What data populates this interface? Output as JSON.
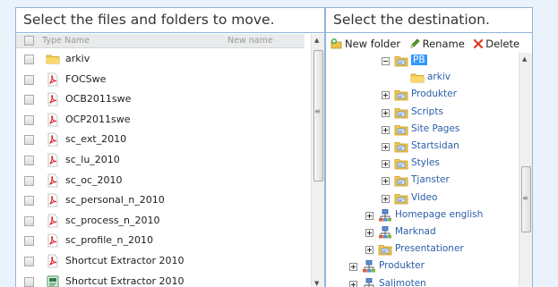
{
  "source_panel": {
    "title": "Select the files and folders to move.",
    "columns": {
      "type": "Type",
      "name": "Name",
      "new_name": "New name"
    },
    "rows": [
      {
        "name": "arkiv",
        "icon": "folder-icon"
      },
      {
        "name": "FOCSwe",
        "icon": "pdf-icon"
      },
      {
        "name": "OCB2011swe",
        "icon": "pdf-icon"
      },
      {
        "name": "OCP2011swe",
        "icon": "pdf-icon"
      },
      {
        "name": "sc_ext_2010",
        "icon": "pdf-icon"
      },
      {
        "name": "sc_lu_2010",
        "icon": "pdf-icon"
      },
      {
        "name": "sc_oc_2010",
        "icon": "pdf-icon"
      },
      {
        "name": "sc_personal_n_2010",
        "icon": "pdf-icon"
      },
      {
        "name": "sc_process_n_2010",
        "icon": "pdf-icon"
      },
      {
        "name": "sc_profile_n_2010",
        "icon": "pdf-icon"
      },
      {
        "name": "Shortcut Extractor 2010",
        "icon": "pdf-icon"
      },
      {
        "name": "Shortcut Extractor 2010",
        "icon": "publisher-icon"
      }
    ]
  },
  "destination_panel": {
    "title": "Select the destination.",
    "toolbar": {
      "new_folder": "New folder",
      "rename": "Rename",
      "delete": "Delete"
    },
    "tree": [
      {
        "label": "PB",
        "icon": "site-folder-icon",
        "expander": "minus",
        "selected": true
      },
      {
        "label": "arkiv",
        "icon": "folder-icon",
        "expander": "none"
      },
      {
        "label": "Produkter",
        "icon": "site-folder-icon",
        "expander": "plus"
      },
      {
        "label": "Scripts",
        "icon": "site-folder-icon",
        "expander": "plus"
      },
      {
        "label": "Site Pages",
        "icon": "site-folder-icon",
        "expander": "plus"
      },
      {
        "label": "Startsidan",
        "icon": "site-folder-icon",
        "expander": "plus"
      },
      {
        "label": "Styles",
        "icon": "site-folder-icon",
        "expander": "plus"
      },
      {
        "label": "Tjanster",
        "icon": "site-folder-icon",
        "expander": "plus"
      },
      {
        "label": "Video",
        "icon": "site-folder-icon",
        "expander": "plus"
      },
      {
        "label": "Homepage english",
        "icon": "site-icon",
        "expander": "plus"
      },
      {
        "label": "Marknad",
        "icon": "site-icon",
        "expander": "plus"
      },
      {
        "label": "Presentationer",
        "icon": "site-folder-icon",
        "expander": "plus"
      },
      {
        "label": "Produkter",
        "icon": "site-icon",
        "expander": "plus"
      },
      {
        "label": "Saljmoten",
        "icon": "site-icon",
        "expander": "plus"
      }
    ]
  },
  "colors": {
    "border": "#8fb4d9",
    "link": "#2a5da8",
    "selected": "#3399ff",
    "background": "#eaf3fb"
  }
}
